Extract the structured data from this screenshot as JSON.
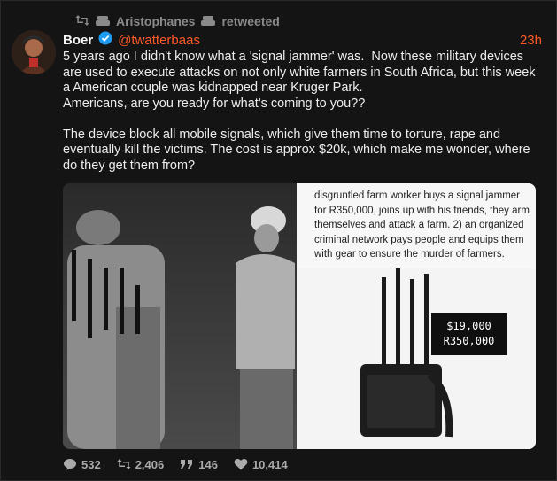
{
  "retweet": {
    "user": "Aristophanes",
    "label": "retweeted"
  },
  "tweet": {
    "author_name": "Boer",
    "handle": "@twatterbaas",
    "time": "23h",
    "text": "5 years ago I didn't know what a 'signal jammer' was.  Now these military devices are used to execute attacks on not only white farmers in South Africa, but this week a American couple was kidnapped near Kruger Park.\nAmericans, are you ready for what's coming to you??\n\nThe device block all mobile signals, which give them time to torture, rape and eventually kill the victims. The cost is approx $20k, which make me wonder, where do they get them from?"
  },
  "media": {
    "caption": "disgruntled farm worker buys a signal jammer for R350,000, joins up with his friends, they arm themselves and attack a farm. 2) an organized criminal network pays people and equips them with gear to ensure the murder of farmers.",
    "price_usd": "$19,000",
    "price_zar": "R350,000"
  },
  "actions": {
    "replies": "532",
    "retweets": "2,406",
    "quotes": "146",
    "likes": "10,414"
  },
  "colors": {
    "accent": "#ff5a28",
    "verified": "#1d9bf0",
    "muted": "#8a8a8a"
  }
}
